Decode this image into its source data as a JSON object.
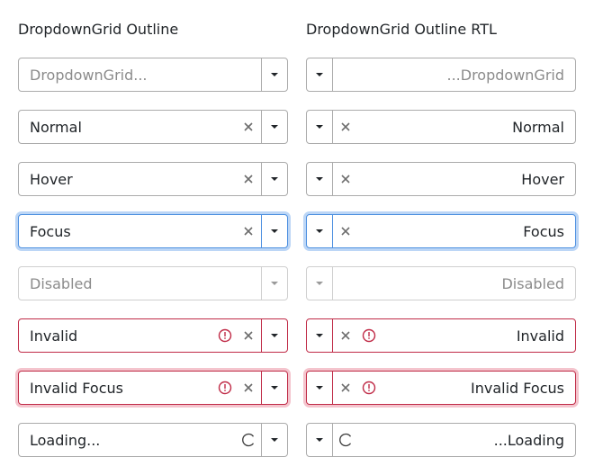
{
  "headings": {
    "ltr": "DropdownGrid Outline",
    "rtl": "DropdownGrid Outline RTL"
  },
  "ltr": {
    "placeholder": "DropdownGrid...",
    "normal": "Normal",
    "hover": "Hover",
    "focus": "Focus",
    "disabled": "Disabled",
    "invalid": "Invalid",
    "invalid_focus": "Invalid Focus",
    "loading": "Loading..."
  },
  "rtl": {
    "placeholder": "...DropdownGrid",
    "normal": "Normal",
    "hover": "Hover",
    "focus": "Focus",
    "disabled": "Disabled",
    "invalid": "Invalid",
    "invalid_focus": "Invalid Focus",
    "loading": "...Loading"
  },
  "icons": {
    "arrow": "chevron-down-icon",
    "clear": "close-icon",
    "invalid": "alert-icon",
    "loading": "spinner-icon"
  },
  "colors": {
    "border": "#ababab",
    "focus": "#4d90e0",
    "focus_ring": "#bcd6f6",
    "invalid": "#c02b47",
    "invalid_ring": "#f4c4cd",
    "muted_text": "#8b8b8b"
  }
}
